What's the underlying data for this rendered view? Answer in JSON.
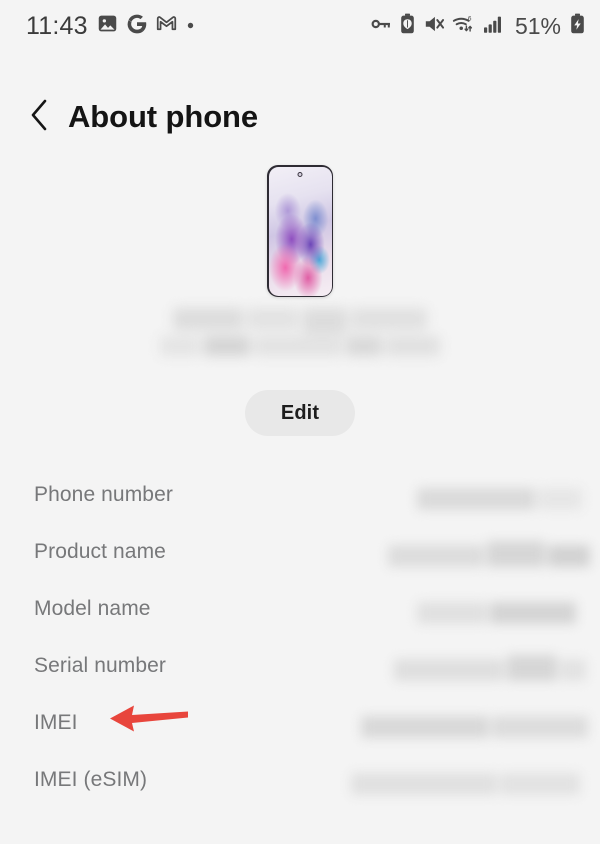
{
  "statusbar": {
    "time": "11:43",
    "battery_percent": "51%",
    "left_icons": [
      {
        "name": "photos-icon"
      },
      {
        "name": "google-icon"
      },
      {
        "name": "gmail-icon"
      },
      {
        "name": "dot-indicator-icon"
      }
    ],
    "right_icons": [
      {
        "name": "vpn-key-icon"
      },
      {
        "name": "battery-saver-icon"
      },
      {
        "name": "volume-muted-icon"
      },
      {
        "name": "wifi-6-icon"
      },
      {
        "name": "cellular-signal-icon"
      },
      {
        "name": "battery-charging-icon"
      }
    ]
  },
  "header": {
    "back_label": "Back",
    "title": "About phone"
  },
  "device": {
    "image_alt": "Samsung Galaxy S20 front view with purple nebula wallpaper",
    "name_redacted": true,
    "edit_label": "Edit"
  },
  "info_rows": [
    {
      "label": "Phone number",
      "value_redacted": true,
      "value_blocks": [
        120,
        44
      ]
    },
    {
      "label": "Product name",
      "value_redacted": true,
      "value_blocks": [
        96,
        60,
        42
      ]
    },
    {
      "label": "Model name",
      "value_redacted": true,
      "value_blocks": [
        70,
        84
      ]
    },
    {
      "label": "Serial number",
      "value_redacted": true,
      "value_blocks": [
        112,
        50,
        26
      ]
    },
    {
      "label": "IMEI",
      "value_redacted": true,
      "value_blocks": [
        130,
        96
      ]
    },
    {
      "label": "IMEI (eSIM)",
      "value_redacted": true,
      "value_blocks": [
        150,
        80
      ]
    }
  ],
  "annotation": {
    "name": "red-arrow-pointing-to-imei",
    "target_row": "IMEI",
    "color": "#e8453c",
    "direction": "left"
  },
  "colors": {
    "background": "#f4f4f4",
    "label_text": "#77787a",
    "title_text": "#141414",
    "redaction_block": "#dcdcdc",
    "edit_button_bg": "#e8e8e8",
    "accent_red": "#e8453c"
  }
}
